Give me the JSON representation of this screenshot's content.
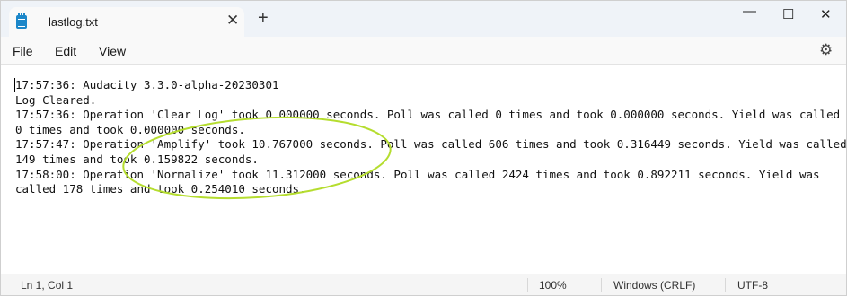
{
  "tab": {
    "title": "lastlog.txt",
    "close": "✕",
    "new": "+"
  },
  "window_controls": {
    "minimize": "—",
    "maximize": "☐",
    "close": "✕"
  },
  "menu": {
    "file": "File",
    "edit": "Edit",
    "view": "View",
    "settings_icon": "⚙"
  },
  "editor": {
    "lines": [
      "17:57:36: Audacity 3.3.0-alpha-20230301",
      "Log Cleared.",
      "17:57:36: Operation 'Clear Log' took 0.000000 seconds. Poll was called 0 times and took 0.000000 seconds. Yield was called",
      "0 times and took 0.000000 seconds.",
      "17:57:47: Operation 'Amplify' took 10.767000 seconds. Poll was called 606 times and took 0.316449 seconds. Yield was called",
      "149 times and took 0.159822 seconds.",
      "17:58:00: Operation 'Normalize' took 11.312000 seconds. Poll was called 2424 times and took 0.892211 seconds. Yield was",
      "called 178 times and took 0.254010 seconds."
    ]
  },
  "annotation": {
    "color": "#b5dd2f"
  },
  "status": {
    "position": "Ln 1, Col 1",
    "zoom": "100%",
    "line_endings": "Windows (CRLF)",
    "encoding": "UTF-8"
  }
}
